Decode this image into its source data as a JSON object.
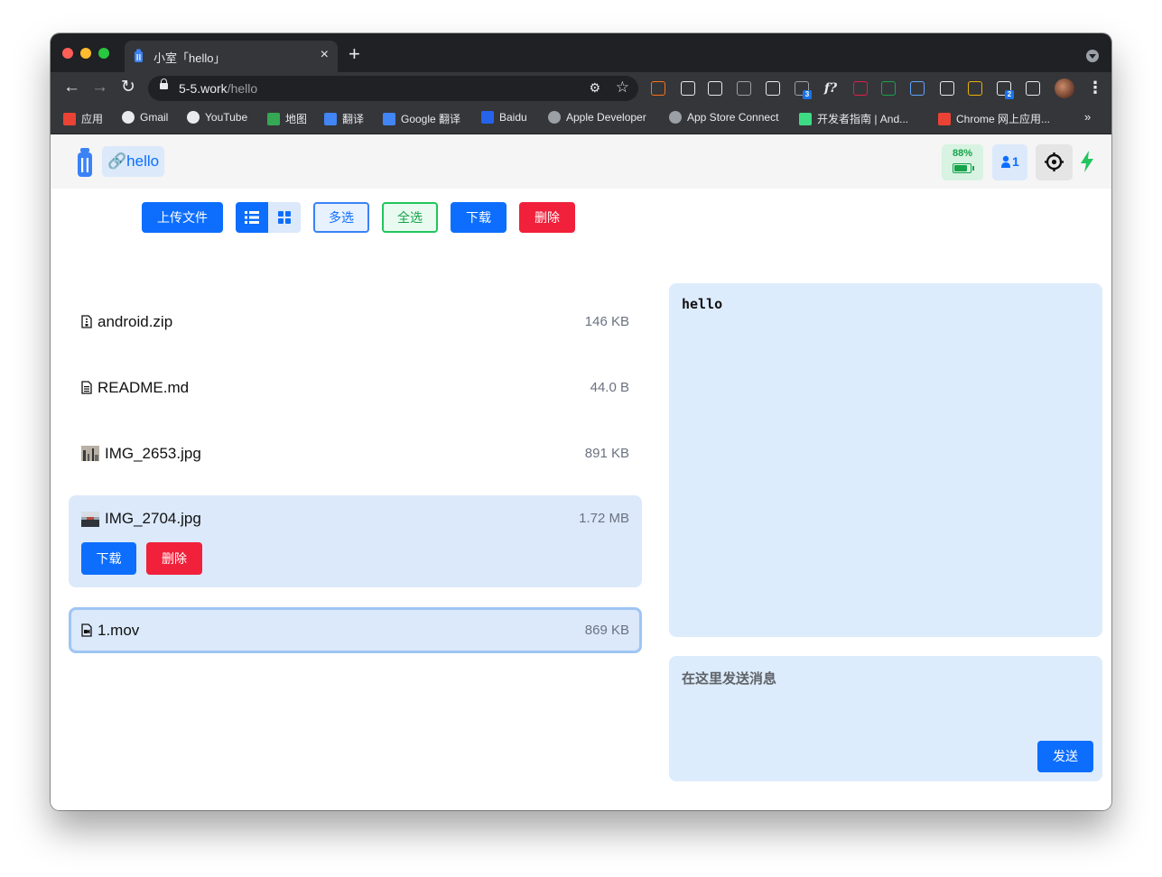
{
  "browser": {
    "tab_title": "小室「hello」",
    "tab_close": "×",
    "new_tab": "+",
    "url_host": "5-5.work",
    "url_path": "/hello",
    "extensions": [
      {
        "icon": "g-ext-icon",
        "color": "#f97316"
      },
      {
        "icon": "check-ext-icon",
        "color": "#e8eaed"
      },
      {
        "icon": "oo-ext-icon",
        "color": "#e8eaed"
      },
      {
        "icon": "cube-ext-icon",
        "color": "#9aa0a6"
      },
      {
        "icon": "y-ext-icon",
        "color": "#e8eaed"
      },
      {
        "icon": "tabs-ext-icon",
        "color": "#9aa0a6",
        "badge": "3"
      },
      {
        "icon": "formula-ext-icon",
        "color": "#e8eaed",
        "label": "f?"
      },
      {
        "icon": "pink-ext-icon",
        "color": "#e11d48"
      },
      {
        "icon": "bug-ext-icon",
        "color": "#16a34a"
      },
      {
        "icon": "w-ext-icon",
        "color": "#60a5fa"
      },
      {
        "icon": "x-ext-icon",
        "color": "#e8eaed"
      },
      {
        "icon": "palette-ext-icon",
        "color": "#eab308"
      },
      {
        "icon": "network-ext-icon",
        "color": "#e8eaed",
        "badge": "2"
      },
      {
        "icon": "puzzle-ext-icon",
        "color": "#e8eaed"
      }
    ],
    "bookmarks": [
      {
        "label": "应用",
        "icon": "apps-grid-icon",
        "color": "#ea4335"
      },
      {
        "label": "Gmail",
        "icon": "globe-icon",
        "color": "#e8eaed"
      },
      {
        "label": "YouTube",
        "icon": "globe-icon",
        "color": "#e8eaed"
      },
      {
        "label": "地图",
        "icon": "maps-pin-icon",
        "color": "#34a853"
      },
      {
        "label": "翻译",
        "icon": "translate-icon",
        "color": "#4285f4"
      },
      {
        "label": "Google 翻译",
        "icon": "translate-icon",
        "color": "#4285f4"
      },
      {
        "label": "Baidu",
        "icon": "baidu-paw-icon",
        "color": "#2563eb"
      },
      {
        "label": "Apple Developer",
        "icon": "apple-icon",
        "color": "#9aa0a6"
      },
      {
        "label": "App Store Connect",
        "icon": "apple-icon",
        "color": "#9aa0a6"
      },
      {
        "label": "开发者指南 | And...",
        "icon": "android-icon",
        "color": "#3ddc84"
      },
      {
        "label": "Chrome 网上应用...",
        "icon": "chrome-store-icon",
        "color": "#ea4335"
      }
    ],
    "bookmarks_more": "»"
  },
  "app": {
    "room_name": "hello",
    "battery": {
      "percent_label": "88%",
      "level": 0.88
    },
    "online_count": "1",
    "accent": "#0d6efd",
    "danger": "#f1203b",
    "success": "#16a34a"
  },
  "actions": {
    "upload": "上传文件",
    "multi_select": "多选",
    "select_all": "全选",
    "download": "下载",
    "delete": "删除"
  },
  "files": [
    {
      "name": "android.zip",
      "size": "146 KB",
      "icon": "zip-file-icon"
    },
    {
      "name": "README.md",
      "size": "44.0 B",
      "icon": "text-file-icon"
    },
    {
      "name": "IMG_2653.jpg",
      "size": "891 KB",
      "icon": "image-thumbnail"
    },
    {
      "name": "IMG_2704.jpg",
      "size": "1.72 MB",
      "icon": "image-thumbnail",
      "download": "下载",
      "delete": "删除"
    },
    {
      "name": "1.mov",
      "size": "869 KB",
      "icon": "video-file-icon"
    }
  ],
  "messages": {
    "latest": "hello"
  },
  "compose": {
    "placeholder": "在这里发送消息",
    "send": "发送"
  }
}
